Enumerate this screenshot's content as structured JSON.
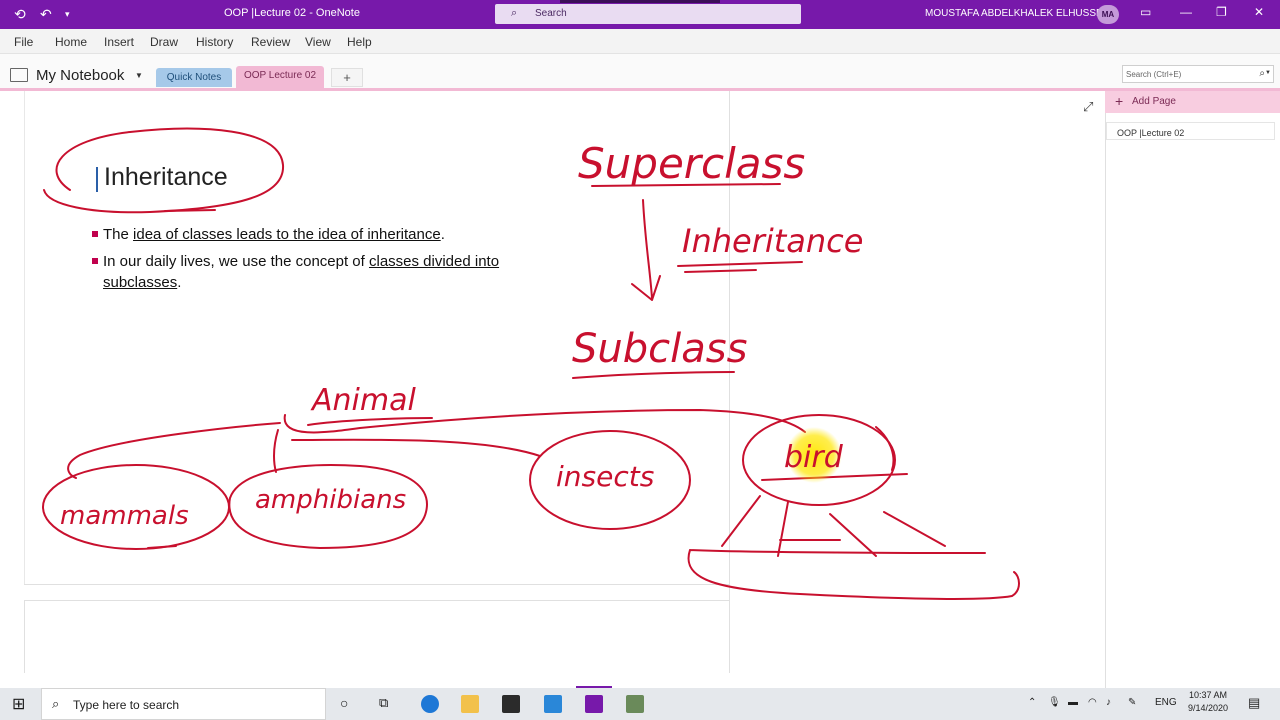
{
  "window": {
    "title": "OOP |Lecture 02  -  OneNote",
    "search_label": "Search",
    "user_name": "MOUSTAFA ABDELKHALEK ELHUSSEI",
    "user_initials": "MA"
  },
  "ribbon": {
    "tabs": [
      "File",
      "Home",
      "Insert",
      "Draw",
      "History",
      "Review",
      "View",
      "Help"
    ]
  },
  "notebook": {
    "name": "My Notebook",
    "sections": [
      "Quick Notes",
      "OOP Lecture 02"
    ],
    "active_section": "OOP Lecture 02",
    "add_section_label": "+",
    "search_placeholder": "Search (Ctrl+E)"
  },
  "pages_pane": {
    "add_page_label": "Add Page",
    "pages": [
      "OOP |Lecture 02"
    ]
  },
  "page": {
    "title": "Inheritance",
    "bullet1_pre": "The ",
    "bullet1_u": "idea of classes leads to the idea of inheritance",
    "bullet1_post": ".",
    "bullet2_pre": "In our daily lives, we use the concept of ",
    "bullet2_u1": "classes divided into",
    "bullet2_u2": "subclasses",
    "bullet2_post": "."
  },
  "handwriting": {
    "superclass": "Superclass",
    "inheritance": "Inheritance",
    "subclass": "Subclass",
    "animal": "Animal",
    "mammals": "mammals",
    "amphibians": "amphibians",
    "insects": "insects",
    "bird": "bird"
  },
  "taskbar": {
    "search_placeholder": "Type here to search",
    "language": "ENG",
    "time": "10:37 AM",
    "date": "9/14/2020"
  },
  "colors": {
    "accent": "#7719aa",
    "ink": "#c8102e",
    "section_active": "#f2b9d4",
    "section_quick": "#a6c9e9",
    "highlight": "#ffe600"
  }
}
